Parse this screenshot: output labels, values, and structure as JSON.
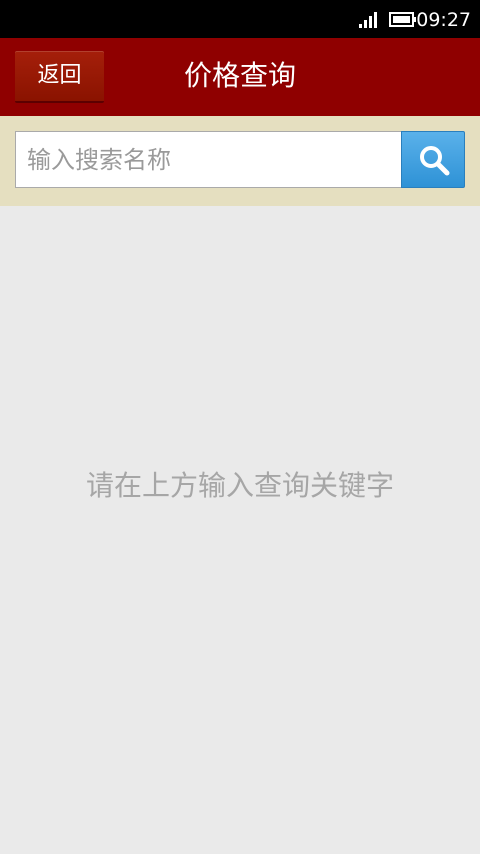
{
  "status_bar": {
    "time": "09:27",
    "signal_icon": "signal-icon",
    "battery_icon": "battery-icon"
  },
  "header": {
    "back_label": "返回",
    "title": "价格查询",
    "background_color": "#8f0000"
  },
  "search": {
    "placeholder": "输入搜索名称",
    "value": "",
    "button_icon": "search-icon",
    "area_color": "#e5dfc0"
  },
  "main": {
    "empty_hint": "请在上方输入查询关键字"
  }
}
